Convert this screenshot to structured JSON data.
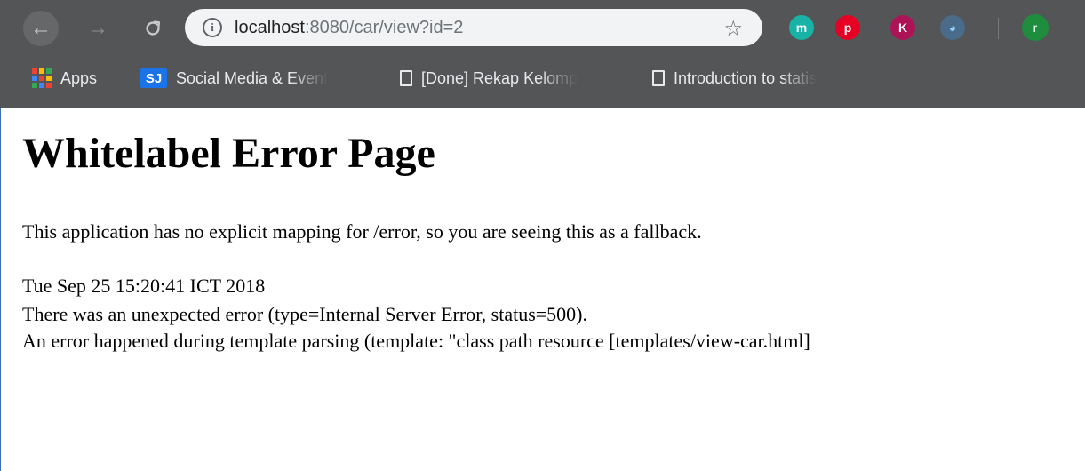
{
  "browser": {
    "url_host": "localhost",
    "url_rest": ":8080/car/view?id=2",
    "nav": {
      "back": "←",
      "forward": "→",
      "reload": "C"
    },
    "info_glyph": "i",
    "star_glyph": "☆",
    "extensions": [
      {
        "name": "mendeley",
        "glyph": "m",
        "color": "#17b3a6"
      },
      {
        "name": "pinterest",
        "glyph": "p",
        "color": "#e60023"
      },
      {
        "name": "k-extension",
        "glyph": "K",
        "color": "#ad1457"
      },
      {
        "name": "sync-extension",
        "glyph": "◕",
        "color": "#4a6c8a"
      }
    ],
    "profile_initial": "r",
    "bookmarks": [
      {
        "label": "Apps",
        "icon": "apps-grid-icon"
      },
      {
        "label": "Social Media & Event",
        "icon": "sj-icon",
        "icon_text": "SJ"
      },
      {
        "label": "[Done] Rekap Kelomp",
        "icon": "page-icon"
      },
      {
        "label": "Introduction to statis",
        "icon": "page-icon"
      }
    ]
  },
  "error_page": {
    "title": "Whitelabel Error Page",
    "message": "This application has no explicit mapping for /error, so you are seeing this as a fallback.",
    "timestamp": "Tue Sep 25 15:20:41 ICT 2018",
    "status_line": "There was an unexpected error (type=Internal Server Error, status=500).",
    "detail": "An error happened during template parsing (template: \"class path resource [templates/view-car.html]"
  },
  "colors": {
    "chrome_bg": "#545557",
    "omnibox_bg": "#f1f3f4",
    "apps_grid": [
      "#ea4335",
      "#fbbc04",
      "#34a853",
      "#4285f4",
      "#ea4335",
      "#fbbc04",
      "#34a853",
      "#4285f4",
      "#ea4335"
    ]
  }
}
